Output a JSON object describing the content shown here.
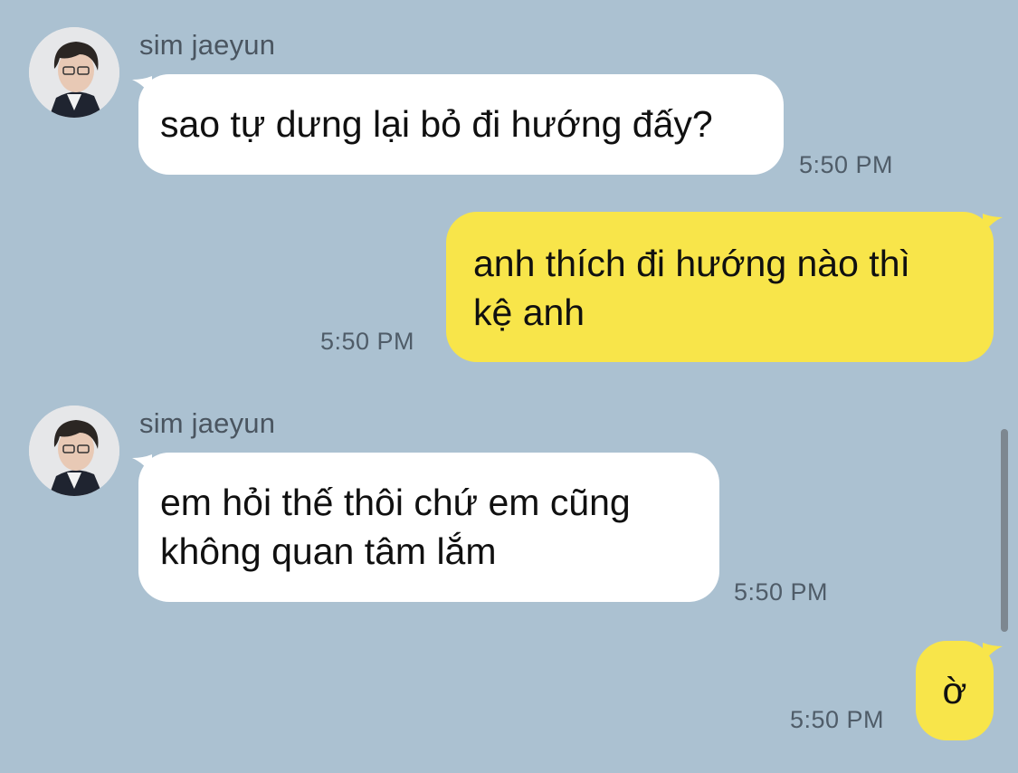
{
  "colors": {
    "background": "#abc1d1",
    "incoming_bubble": "#ffffff",
    "outgoing_bubble": "#f8e54a",
    "timestamp_text": "#4f5c68"
  },
  "messages": [
    {
      "direction": "incoming",
      "sender": "sim jaeyun",
      "avatar": "profile-photo",
      "text_lines": [
        "sao tự dưng lại bỏ đi hướng đấy?"
      ],
      "time": "5:50 PM"
    },
    {
      "direction": "outgoing",
      "text_lines": [
        "anh thích đi hướng nào thì",
        "kệ anh"
      ],
      "time": "5:50 PM"
    },
    {
      "direction": "incoming",
      "sender": "sim jaeyun",
      "avatar": "profile-photo",
      "text_lines": [
        "em hỏi thế thôi chứ em cũng",
        "không quan tâm lắm"
      ],
      "time": "5:50 PM"
    },
    {
      "direction": "outgoing",
      "text_lines": [
        "ờ"
      ],
      "time": "5:50 PM"
    }
  ]
}
